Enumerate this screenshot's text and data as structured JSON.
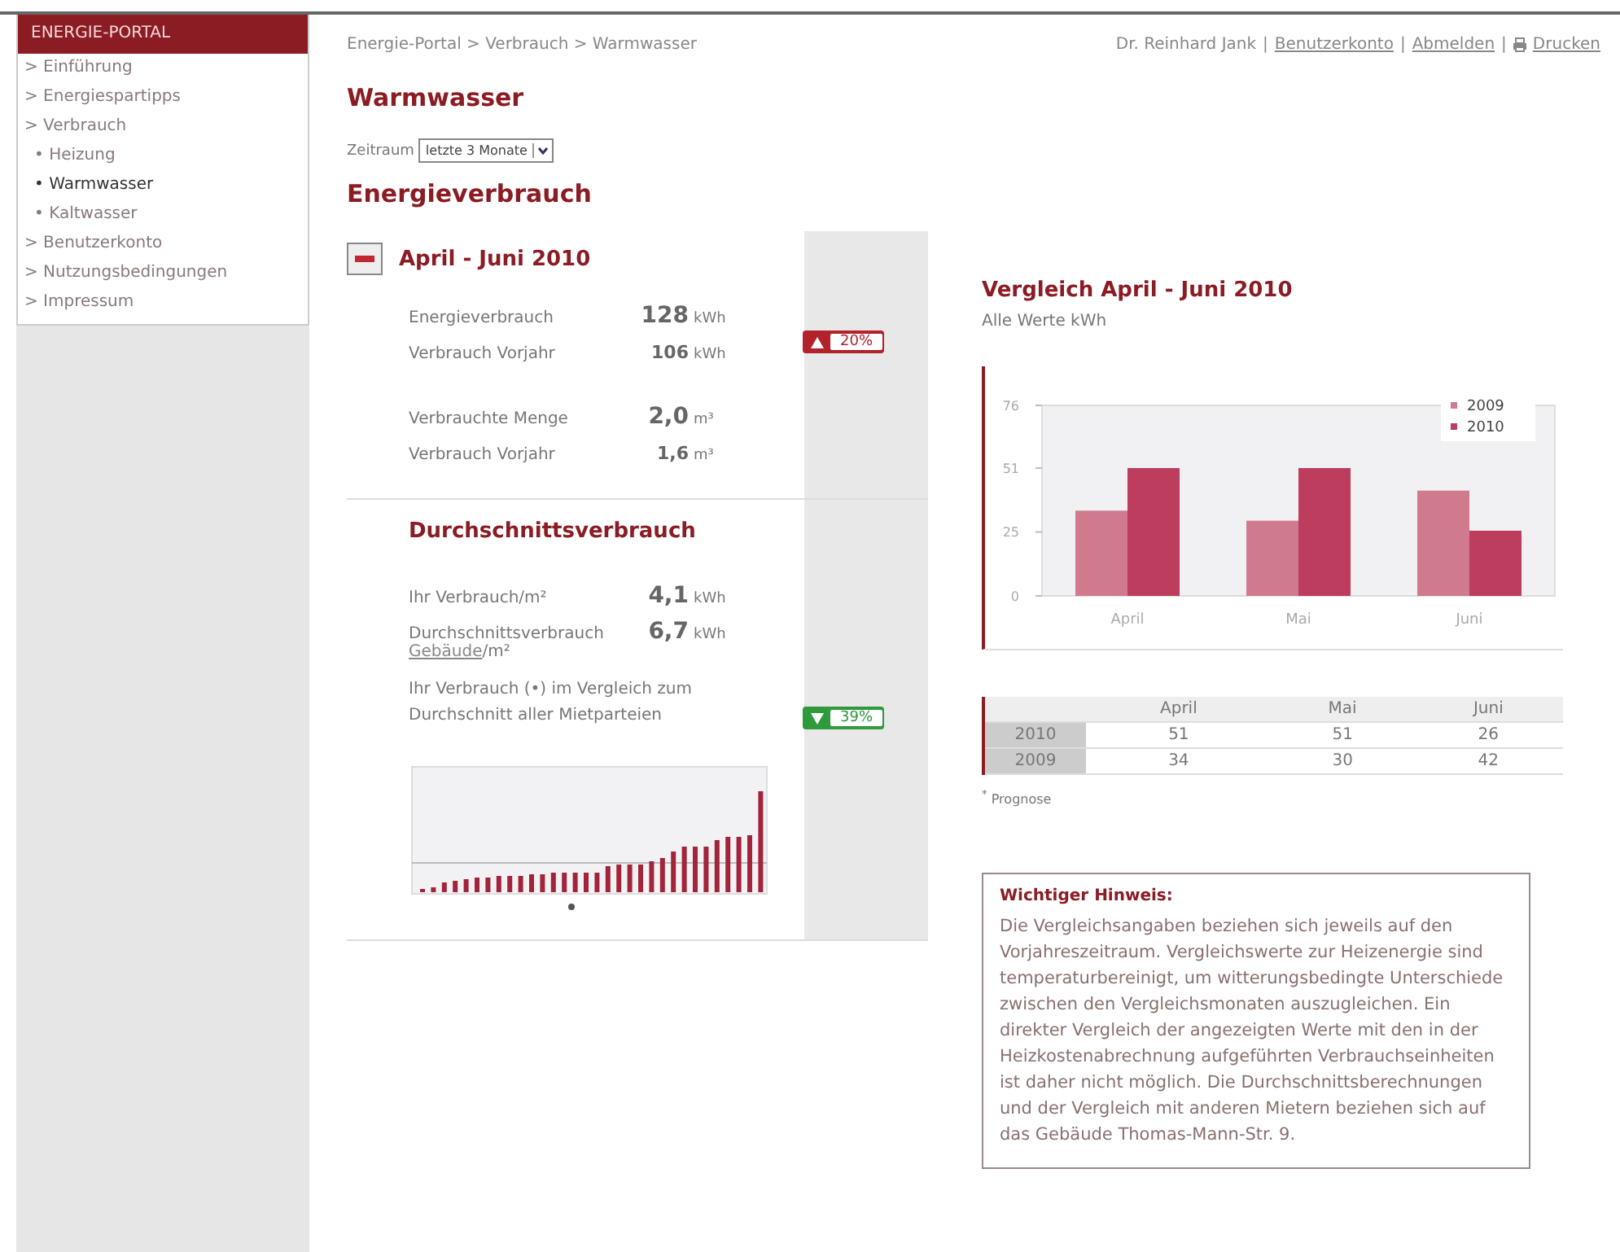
{
  "sidebar": {
    "title": "ENERGIE-PORTAL",
    "items": [
      {
        "label": "> Einführung",
        "selected": false
      },
      {
        "label": "> Energiespartipps",
        "selected": false
      },
      {
        "label": "> Verbrauch",
        "selected": false,
        "children": [
          {
            "label": "• Heizung",
            "selected": false
          },
          {
            "label": "• Warmwasser",
            "selected": true
          },
          {
            "label": "• Kaltwasser",
            "selected": false
          }
        ]
      },
      {
        "label": "> Benutzerkonto",
        "selected": false
      },
      {
        "label": "> Nutzungsbedingungen",
        "selected": false
      },
      {
        "label": "> Impressum",
        "selected": false
      }
    ]
  },
  "breadcrumb": "Energie-Portal > Verbrauch > Warmwasser",
  "top_links": [
    {
      "kind": "text",
      "label": "Dr. Reinhard Jank"
    },
    {
      "kind": "link",
      "label": "Benutzerkonto"
    },
    {
      "kind": "link",
      "label": "Abmelden"
    },
    {
      "kind": "print",
      "label": "Drucken"
    }
  ],
  "top_separator": "|",
  "page_title": "Warmwasser",
  "period": {
    "label": "Zeitraum",
    "value": "letzte 3 Monate"
  },
  "section_title": "Energieverbrauch",
  "period_block": {
    "title": "April - Juni 2010",
    "expanded": true,
    "groups": [
      {
        "rows": [
          {
            "label": "Energieverbrauch",
            "value": "128",
            "unit": "kWh",
            "large": true
          },
          {
            "label": "Verbrauch Vorjahr",
            "value": "106",
            "unit": "kWh",
            "large": false
          }
        ],
        "badge": {
          "kind": "up",
          "text": "20%"
        }
      },
      {
        "rows": [
          {
            "label": "Verbrauchte Menge",
            "value": "2,0",
            "unit": "m³",
            "large": true
          },
          {
            "label": "Verbrauch Vorjahr",
            "value": "1,6",
            "unit": "m³",
            "large": false
          }
        ]
      }
    ]
  },
  "average": {
    "title": "Durchschnittsverbrauch",
    "rows": [
      {
        "label": "Ihr Verbrauch/m²",
        "value": "4,1",
        "unit": "kWh"
      },
      {
        "label": "Durchschnittsverbrauch",
        "link": "Gebäude",
        "suffix": "/m²",
        "value": "6,7",
        "unit": "kWh"
      }
    ],
    "comparison_text": "Ihr Verbrauch (•) im Vergleich zum Durchschnitt aller Mietparteien",
    "badge": {
      "kind": "down",
      "text": "39%"
    }
  },
  "comparison": {
    "title": "Vergleich April - Juni 2010",
    "subtitle": "Alle Werte kWh",
    "chart_data": {
      "type": "bar",
      "categories": [
        "April",
        "Mai",
        "Juni"
      ],
      "series": [
        {
          "name": "2009",
          "color": "#d07a8e",
          "values": [
            34,
            30,
            42
          ]
        },
        {
          "name": "2010",
          "color": "#bc3d5e",
          "values": [
            51,
            51,
            26
          ]
        }
      ],
      "legend": true,
      "ylim": [
        0,
        76
      ],
      "yticks": [
        0,
        {
          "value": 25.5,
          "label": "25"
        },
        51,
        76
      ]
    },
    "table": {
      "columns": [
        "April",
        "Mai",
        "Juni"
      ],
      "rows": [
        {
          "year": "2010",
          "values": [
            "51",
            "51",
            "26"
          ]
        },
        {
          "year": "2009",
          "values": [
            "34",
            "30",
            "42"
          ]
        }
      ]
    },
    "footnote": "$^{*}$ Prognose"
  },
  "notice": {
    "title": "Wichtiger Hinweis:",
    "text": "Die Vergleichsangaben beziehen sich jeweils auf den Vorjahreszeitraum. Vergleichswerte zur Heizenergie sind temperaturbereinigt, um witterungsbedingte Unterschiede zwischen den Vergleichsmonaten auszugleichen. Ein direkter Vergleich der angezeigten Werte mit den in der Heizkostenabrechnung aufgeführten Verbrauchseinheiten ist daher nicht möglich. Die Durchschnittsberechnungen und der Vergleich mit anderen Mietern beziehen sich auf das Gebäude Thomas-Mann-Str. 9."
  }
}
